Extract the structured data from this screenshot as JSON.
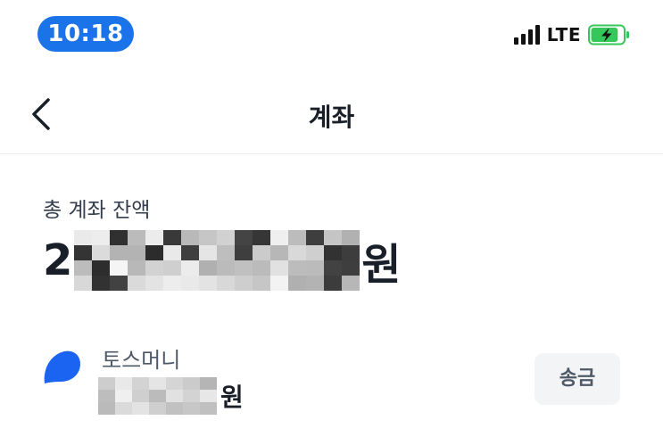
{
  "status_bar": {
    "time": "10:18",
    "network": "LTE",
    "signal_bars": 4,
    "battery_level": 0.85,
    "battery_charging": true,
    "colors": {
      "time_pill": "#1a73e8",
      "battery": "#34c759"
    }
  },
  "header": {
    "title": "계좌",
    "back_icon": "chevron-left-icon"
  },
  "balance": {
    "label": "총 계좌 잔액",
    "amount_prefix": "2",
    "amount_hidden": true,
    "unit": "원"
  },
  "accounts": [
    {
      "name": "토스머니",
      "amount_hidden": true,
      "unit": "원",
      "action_label": "송금",
      "logo_icon": "toss-logo-icon",
      "logo_color": "#1b64f1"
    }
  ]
}
